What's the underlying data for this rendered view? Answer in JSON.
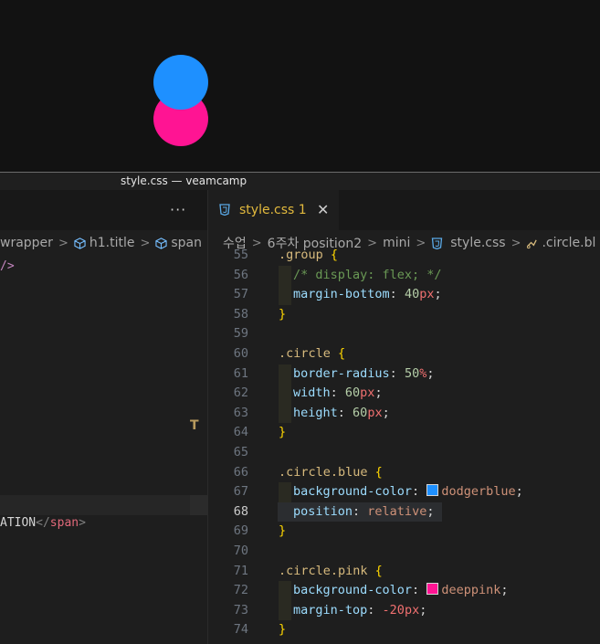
{
  "preview": {
    "colors": {
      "blue": "#1e90ff",
      "pink": "#ff1493"
    }
  },
  "window": {
    "title": "style.css — veamcamp"
  },
  "left_editor": {
    "more_actions": "···",
    "breadcrumb": [
      "wrapper",
      "h1.title",
      "span"
    ],
    "code_top": "/>",
    "code_bottom": {
      "text": "ATION",
      "close_tag": "</",
      "tag": "span",
      "end": ">"
    }
  },
  "right_editor": {
    "tab": {
      "label": "style.css 1",
      "close": "✕"
    },
    "breadcrumb": [
      "수업",
      "6주차 position2",
      "mini",
      "style.css",
      ".circle.bl"
    ],
    "lines": [
      {
        "n": "55",
        "parts": [
          {
            "c": "sel",
            "t": ".group"
          },
          {
            "c": "brace",
            "t": " {"
          }
        ]
      },
      {
        "n": "56",
        "parts": [
          {
            "c": "comment",
            "t": "/* display: flex; */"
          }
        ],
        "indent": true
      },
      {
        "n": "57",
        "parts": [
          {
            "c": "prop",
            "t": "margin-bottom"
          },
          {
            "c": "punct",
            "t": ": "
          },
          {
            "c": "num",
            "t": "40"
          },
          {
            "c": "unit",
            "t": "px"
          },
          {
            "c": "punct",
            "t": ";"
          }
        ],
        "indent": true
      },
      {
        "n": "58",
        "parts": [
          {
            "c": "brace",
            "t": "}"
          }
        ]
      },
      {
        "n": "59",
        "parts": []
      },
      {
        "n": "60",
        "parts": [
          {
            "c": "sel",
            "t": ".circle"
          },
          {
            "c": "brace",
            "t": " {"
          }
        ]
      },
      {
        "n": "61",
        "parts": [
          {
            "c": "prop",
            "t": "border-radius"
          },
          {
            "c": "punct",
            "t": ": "
          },
          {
            "c": "num",
            "t": "50"
          },
          {
            "c": "unit",
            "t": "%"
          },
          {
            "c": "punct",
            "t": ";"
          }
        ],
        "indent": true
      },
      {
        "n": "62",
        "parts": [
          {
            "c": "prop",
            "t": "width"
          },
          {
            "c": "punct",
            "t": ": "
          },
          {
            "c": "num",
            "t": "60"
          },
          {
            "c": "unit",
            "t": "px"
          },
          {
            "c": "punct",
            "t": ";"
          }
        ],
        "indent": true
      },
      {
        "n": "63",
        "parts": [
          {
            "c": "prop",
            "t": "height"
          },
          {
            "c": "punct",
            "t": ": "
          },
          {
            "c": "num",
            "t": "60"
          },
          {
            "c": "unit",
            "t": "px"
          },
          {
            "c": "punct",
            "t": ";"
          }
        ],
        "indent": true
      },
      {
        "n": "64",
        "parts": [
          {
            "c": "brace",
            "t": "}"
          }
        ]
      },
      {
        "n": "65",
        "parts": []
      },
      {
        "n": "66",
        "parts": [
          {
            "c": "sel",
            "t": ".circle.blue"
          },
          {
            "c": "brace",
            "t": " {"
          }
        ]
      },
      {
        "n": "67",
        "parts": [
          {
            "c": "prop",
            "t": "background-color"
          },
          {
            "c": "punct",
            "t": ": "
          },
          {
            "c": "swatch",
            "t": "#1e90ff"
          },
          {
            "c": "val",
            "t": "dodgerblue"
          },
          {
            "c": "punct",
            "t": ";"
          }
        ],
        "indent": true
      },
      {
        "n": "68",
        "parts": [
          {
            "c": "prop",
            "t": "position"
          },
          {
            "c": "punct",
            "t": ": "
          },
          {
            "c": "val",
            "t": "relative"
          },
          {
            "c": "punct",
            "t": ";"
          }
        ],
        "indent": true,
        "active": true
      },
      {
        "n": "69",
        "parts": [
          {
            "c": "brace",
            "t": "}"
          }
        ]
      },
      {
        "n": "70",
        "parts": []
      },
      {
        "n": "71",
        "parts": [
          {
            "c": "sel",
            "t": ".circle.pink"
          },
          {
            "c": "brace",
            "t": " {"
          }
        ]
      },
      {
        "n": "72",
        "parts": [
          {
            "c": "prop",
            "t": "background-color"
          },
          {
            "c": "punct",
            "t": ": "
          },
          {
            "c": "swatch",
            "t": "#ff1493"
          },
          {
            "c": "val",
            "t": "deeppink"
          },
          {
            "c": "punct",
            "t": ";"
          }
        ],
        "indent": true
      },
      {
        "n": "73",
        "parts": [
          {
            "c": "prop",
            "t": "margin-top"
          },
          {
            "c": "punct",
            "t": ": "
          },
          {
            "c": "unit",
            "t": "-20"
          },
          {
            "c": "unit",
            "t": "px"
          },
          {
            "c": "punct",
            "t": ";"
          }
        ],
        "indent": true
      },
      {
        "n": "74",
        "parts": [
          {
            "c": "brace",
            "t": "}"
          }
        ]
      }
    ]
  },
  "marker": "T"
}
